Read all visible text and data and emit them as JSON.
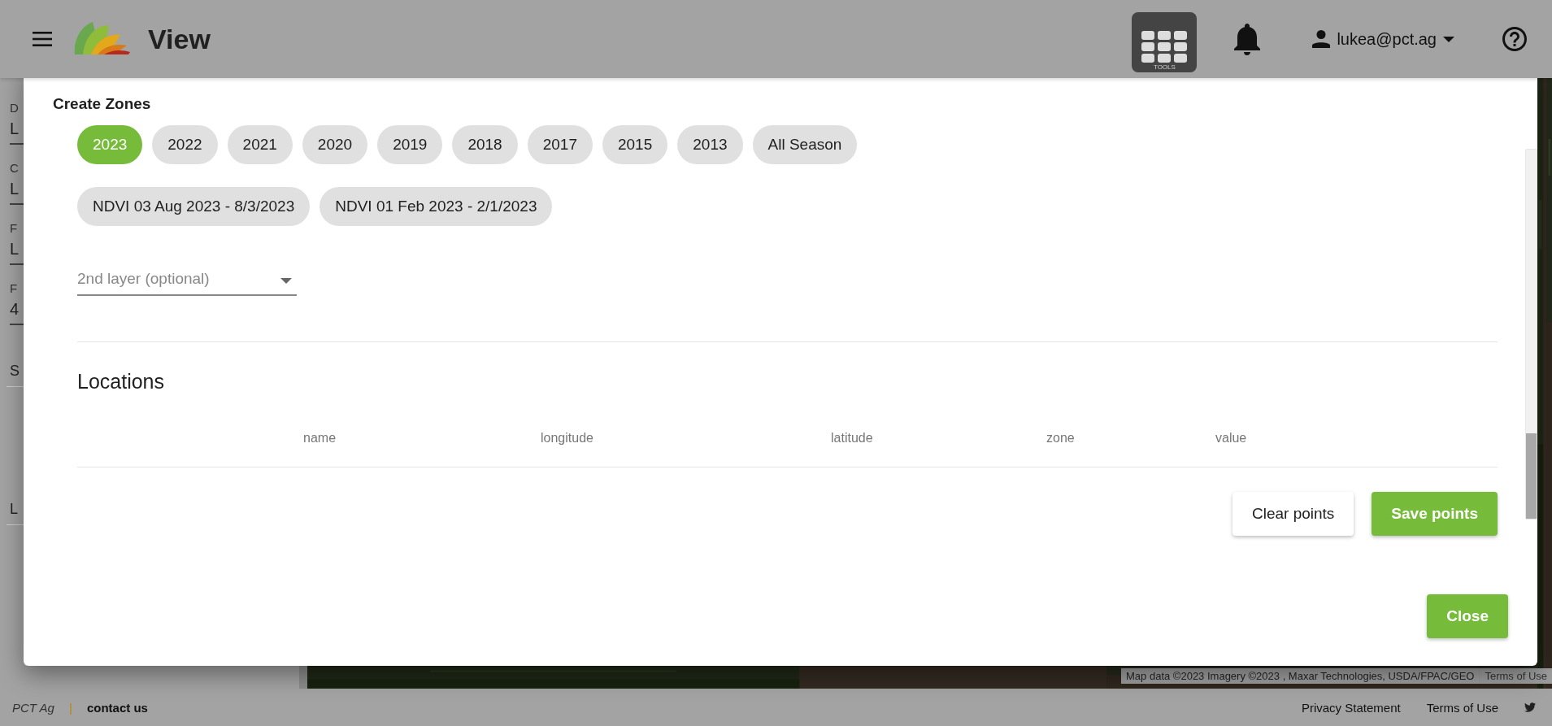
{
  "header": {
    "title": "View",
    "tools_label": "TOOLS",
    "user": "lukea@pct.ag"
  },
  "sidebar": {
    "fields": [
      {
        "label": "D",
        "value": "L"
      },
      {
        "label": "C",
        "value": "L"
      },
      {
        "label": "F",
        "value": "L"
      },
      {
        "label": "F",
        "value": "4"
      }
    ],
    "sections": [
      "S",
      "L"
    ]
  },
  "map": {
    "attribution": "Map data ©2023 Imagery ©2023 , Maxar Technologies, USDA/FPAC/GEO",
    "terms": "Terms of Use"
  },
  "dialog": {
    "title": "Create Zones",
    "years": [
      {
        "label": "2023",
        "selected": true
      },
      {
        "label": "2022",
        "selected": false
      },
      {
        "label": "2021",
        "selected": false
      },
      {
        "label": "2020",
        "selected": false
      },
      {
        "label": "2019",
        "selected": false
      },
      {
        "label": "2018",
        "selected": false
      },
      {
        "label": "2017",
        "selected": false
      },
      {
        "label": "2015",
        "selected": false
      },
      {
        "label": "2013",
        "selected": false
      },
      {
        "label": "All Season",
        "selected": false
      }
    ],
    "layers": [
      {
        "label": "NDVI 03 Aug 2023 - 8/3/2023",
        "selected": false
      },
      {
        "label": "NDVI 01 Feb 2023 - 2/1/2023",
        "selected": false
      }
    ],
    "second_layer": {
      "placeholder": "2nd layer (optional)"
    },
    "locations": {
      "title": "Locations",
      "columns": [
        "name",
        "longitude",
        "latitude",
        "zone",
        "value"
      ]
    },
    "buttons": [
      {
        "label": "Clear points",
        "kind": "secondary"
      },
      {
        "label": "Save points",
        "kind": "primary"
      }
    ],
    "close": "Close"
  },
  "footer": {
    "brand": "PCT Ag",
    "separator": "|",
    "contact": "contact us",
    "links": [
      "Privacy Statement",
      "Terms of Use"
    ]
  }
}
